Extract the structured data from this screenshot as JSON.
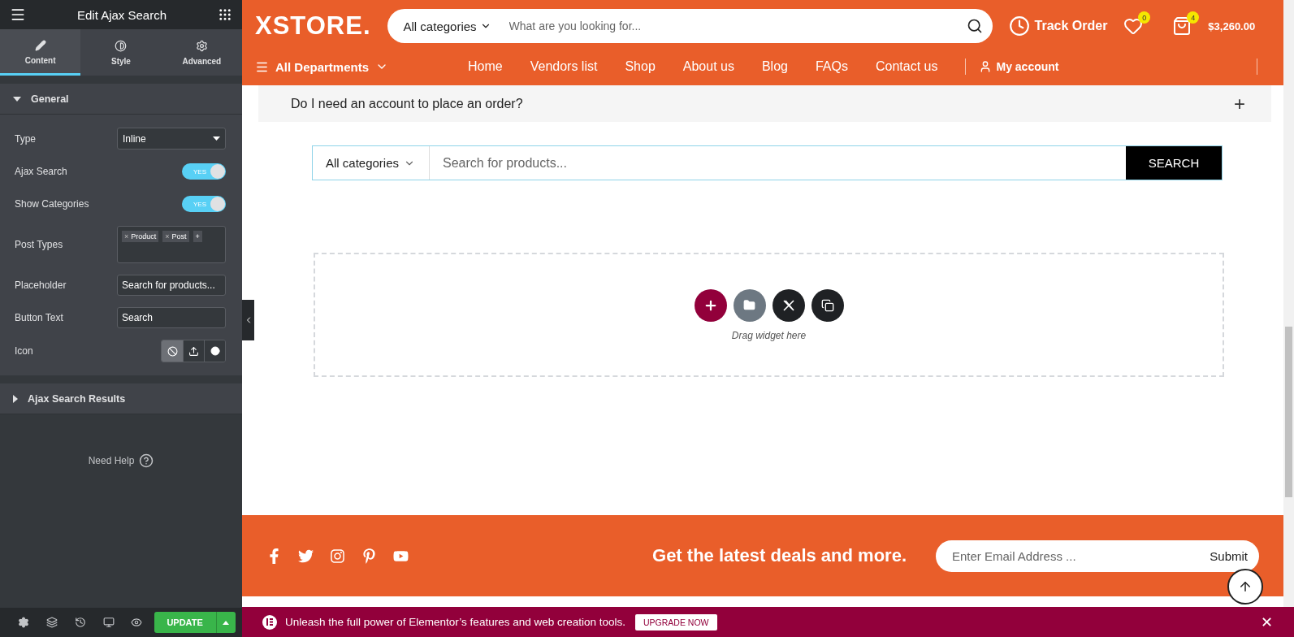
{
  "editor": {
    "title": "Edit Ajax Search",
    "tabs": [
      {
        "label": "Content",
        "selected": true
      },
      {
        "label": "Style",
        "selected": false
      },
      {
        "label": "Advanced",
        "selected": false
      }
    ],
    "sections": [
      {
        "title": "General",
        "expanded": true,
        "controls": [
          {
            "kind": "select",
            "label": "Type",
            "value": "Inline"
          },
          {
            "kind": "switch",
            "label": "Ajax Search",
            "on": true,
            "text": "YES"
          },
          {
            "kind": "switch",
            "label": "Show Categories",
            "on": true,
            "text": "YES"
          },
          {
            "kind": "tags",
            "label": "Post Types",
            "tags": [
              {
                "remove": "×",
                "label": "Product"
              },
              {
                "remove": "×",
                "label": "Post"
              }
            ],
            "add": "+"
          },
          {
            "kind": "text",
            "label": "Placeholder",
            "value": "Search for products..."
          },
          {
            "kind": "text",
            "label": "Button Text",
            "value": "Search"
          },
          {
            "kind": "choice",
            "label": "Icon",
            "options": [
              {
                "kind": "none",
                "selected": true
              },
              {
                "kind": "upload",
                "selected": false
              },
              {
                "kind": "circle",
                "selected": false
              }
            ]
          }
        ]
      },
      {
        "title": "Ajax Search Results",
        "expanded": false
      }
    ],
    "help": "Need Help",
    "update": "UPDATE"
  },
  "preview": {
    "header": {
      "logo": "XSTORE.",
      "category": "All categories",
      "search_placeholder": "What are you looking for...",
      "track_order": "Track Order",
      "wishlist_count": "0",
      "cart_count": "4",
      "cart_total": "$3,260.00",
      "departments": "All Departments",
      "nav": [
        "Home",
        "Vendors list",
        "Shop",
        "About us",
        "Blog",
        "FAQs",
        "Contact us"
      ],
      "account": "My account"
    },
    "faq": {
      "question": "Do I need an account to place an order?",
      "toggle": "+"
    },
    "search_widget": {
      "category": "All categories",
      "placeholder": "Search for products...",
      "button": "SEARCH"
    },
    "drop_zone": {
      "hint": "Drag widget here"
    },
    "footer": {
      "tagline": "Get the latest deals and more.",
      "email_placeholder": "Enter Email Address ...",
      "submit": "Submit"
    },
    "promo": {
      "text": "Unleash the full power of Elementor’s features and web creation tools.",
      "button": "UPGRADE NOW",
      "close": "✕"
    }
  }
}
